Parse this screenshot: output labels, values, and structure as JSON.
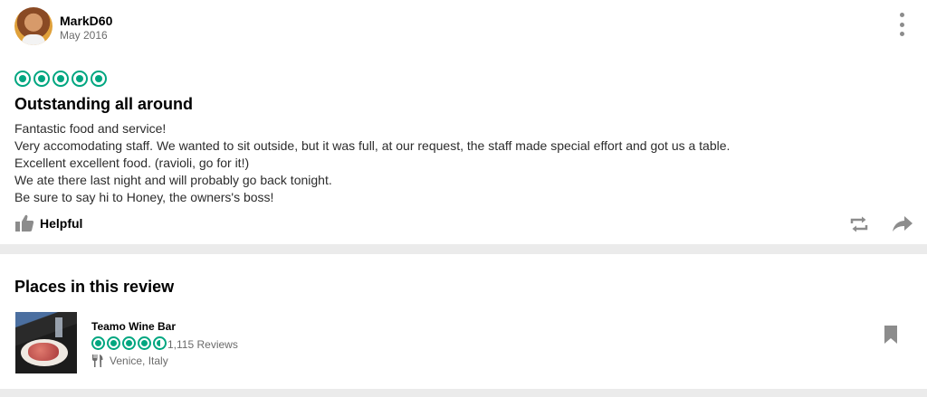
{
  "review": {
    "username": "MarkD60",
    "date": "May 2016",
    "rating": 5,
    "rating_max": 5,
    "title": "Outstanding all around",
    "body": [
      "Fantastic food and service!",
      "Very accomodating staff. We wanted to sit outside, but it was full, at our request, the staff made special effort and got us a table.",
      "Excellent excellent food. (ravioli, go for it!)",
      "We ate there last night and will probably go back tonight.",
      "Be sure to say hi to Honey, the owners's boss!"
    ],
    "helpful_label": "Helpful"
  },
  "places": {
    "heading": "Places in this review",
    "items": [
      {
        "name": "Teamo Wine Bar",
        "rating": 4.5,
        "rating_max": 5,
        "reviews_label": "1,115 Reviews",
        "location": "Venice, Italy"
      }
    ]
  },
  "colors": {
    "accent": "#00a680",
    "muted_icon": "#8c8c8c",
    "secondary_text": "#6b6b6b"
  },
  "icons": {
    "more": "vertical-dots-icon",
    "helpful": "thumbs-up-icon",
    "repost": "repost-icon",
    "share": "share-arrow-icon",
    "location": "fork-knife-icon",
    "save": "bookmark-icon"
  }
}
